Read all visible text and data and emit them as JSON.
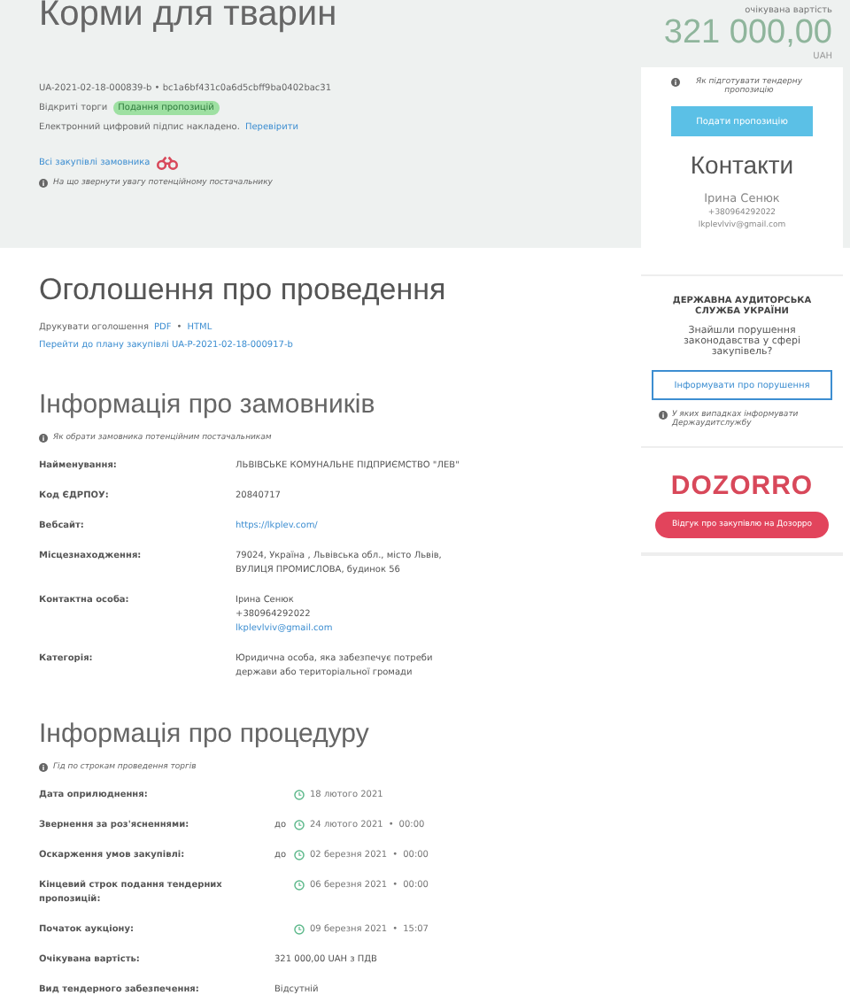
{
  "title": "Корми для тварин",
  "tender_id": "UA-2021-02-18-000839-b • bc1a6bf431c0a6d5cbff9ba0402bac31",
  "procedure_type": "Відкриті торги",
  "status_badge": "Подання пропозицій",
  "signature": {
    "text": "Електронний цифровий підпис накладено.",
    "link": "Перевірити"
  },
  "buyer_link": "Всі закупівлі замовника",
  "header_hint": "На що звернути увагу потенційному постачальнику",
  "announcement": {
    "heading": "Оголошення про проведення",
    "print_label": "Друкувати оголошення",
    "print_links": [
      "PDF",
      "HTML"
    ],
    "link_separator": "•",
    "plan_link": "Перейти до плану закупівлі UA-P-2021-02-18-000917-b"
  },
  "customers": {
    "heading": "Інформація про замовників",
    "hint": "Як обрати замовника потенційним постачальникам",
    "rows": [
      {
        "label": "Найменування:",
        "lines": [
          {
            "kind": "text",
            "text": "ЛЬВІВСЬКЕ КОМУНАЛЬНЕ ПІДПРИЄМСТВО \"ЛЕВ\""
          }
        ]
      },
      {
        "label": "Код ЄДРПОУ:",
        "lines": [
          {
            "kind": "text",
            "text": "20840717"
          }
        ]
      },
      {
        "label": "Вебсайт:",
        "lines": [
          {
            "kind": "link",
            "text": "https://lkplev.com/"
          }
        ]
      },
      {
        "label": "Місцезнаходження:",
        "lines": [
          {
            "kind": "text",
            "text": "79024, Україна , Львівська обл., місто Львів,"
          },
          {
            "kind": "text",
            "text": "ВУЛИЦЯ ПРОМИСЛОВА, будинок 56"
          }
        ]
      },
      {
        "label": "Контактна особа:",
        "lines": [
          {
            "kind": "text",
            "text": "Ірина Сенюк"
          },
          {
            "kind": "text",
            "text": "+380964292022"
          },
          {
            "kind": "link",
            "text": "lkplevlviv@gmail.com"
          }
        ]
      },
      {
        "label": "Категорія:",
        "lines": [
          {
            "kind": "text",
            "text": "Юридична особа, яка забезпечує потреби"
          },
          {
            "kind": "text",
            "text": "держави або територіальної громади"
          }
        ]
      }
    ]
  },
  "procedure": {
    "heading": "Інформація про процедуру",
    "hint": "Гід по строкам проведення торгів",
    "time_separator": "•",
    "rows": [
      {
        "kind": "date",
        "label": "Дата оприлюднення:",
        "date": "18 лютого 2021"
      },
      {
        "kind": "date",
        "label": "Звернення за роз'ясненнями:",
        "prefix": "до",
        "date": "24 лютого 2021",
        "time": "00:00"
      },
      {
        "kind": "date",
        "label": "Оскарження умов закупівлі:",
        "prefix": "до",
        "date": "02 березня 2021",
        "time": "00:00"
      },
      {
        "kind": "date",
        "label": "Кінцевий строк подання тендерних пропозицій:",
        "date": "06 березня 2021",
        "time": "00:00"
      },
      {
        "kind": "date",
        "label": "Початок аукціону:",
        "date": "09 березня 2021",
        "time": "15:07"
      },
      {
        "kind": "text",
        "label": "Очікувана вартість:",
        "value": "321 000,00 UAH з ПДВ"
      },
      {
        "kind": "text",
        "label": "Вид тендерного забезпечення:",
        "value": "Відсутній"
      }
    ]
  },
  "sidebar": {
    "value_caption": "очікувана вартість",
    "value": "321 000,00",
    "currency": "UAH",
    "bid_hint": "Як підготувати тендерну пропозицію",
    "bid_button": "Подати пропозицію",
    "contacts": {
      "heading": "Контакти",
      "name": "Ірина Сенюк",
      "phone": "+380964292022",
      "email": "lkplevlviv@gmail.com"
    },
    "audit": {
      "heading": "ДЕРЖАВНА АУДИТОРСЬКА СЛУЖБА УКРАЇНИ",
      "question": "Знайшли порушення законодавства у сфері закупівель?",
      "button": "Інформувати про порушення",
      "hint": "У яких випадках інформувати Держаудитслужбу"
    },
    "dozorro": {
      "logo": "DOZORRO",
      "button": "Відгук про закупівлю на Дозорро"
    }
  }
}
